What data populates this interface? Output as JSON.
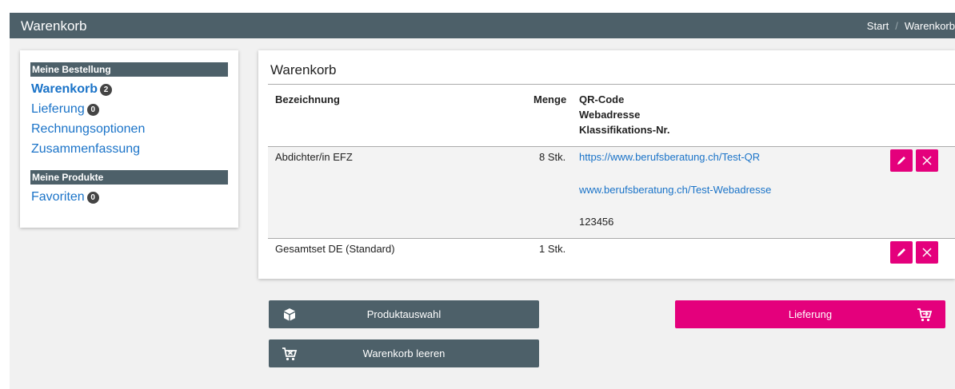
{
  "header": {
    "title": "Warenkorb",
    "breadcrumb": {
      "home": "Start",
      "separator": "/",
      "current": "Warenkorb"
    }
  },
  "sidebar": {
    "section1": "Meine Bestellung",
    "cart": {
      "label": "Warenkorb",
      "count": "2"
    },
    "delivery": {
      "label": "Lieferung",
      "count": "0"
    },
    "billing": "Rechnungsoptionen",
    "summary": "Zusammenfassung",
    "section2": "Meine Produkte",
    "favorites": {
      "label": "Favoriten",
      "count": "0"
    }
  },
  "cart": {
    "title": "Warenkorb",
    "columns": {
      "name": "Bezeichnung",
      "qty": "Menge",
      "qr": "QR-Code",
      "web": "Webadresse",
      "class": "Klassifikations-Nr."
    },
    "rows": [
      {
        "name": "Abdichter/in EFZ",
        "qty": "8 Stk.",
        "qr": "https://www.berufsberatung.ch/Test-QR",
        "web": "www.berufsberatung.ch/Test-Webadresse",
        "class_nr": "123456"
      },
      {
        "name": "Gesamtset DE (Standard)",
        "qty": "1 Stk."
      }
    ]
  },
  "buttons": {
    "products": "Produktauswahl",
    "clear_cart": "Warenkorb leeren",
    "delivery": "Lieferung"
  },
  "colors": {
    "header": "#4d6069",
    "accent": "#e4007c",
    "link": "#1a73c8"
  }
}
